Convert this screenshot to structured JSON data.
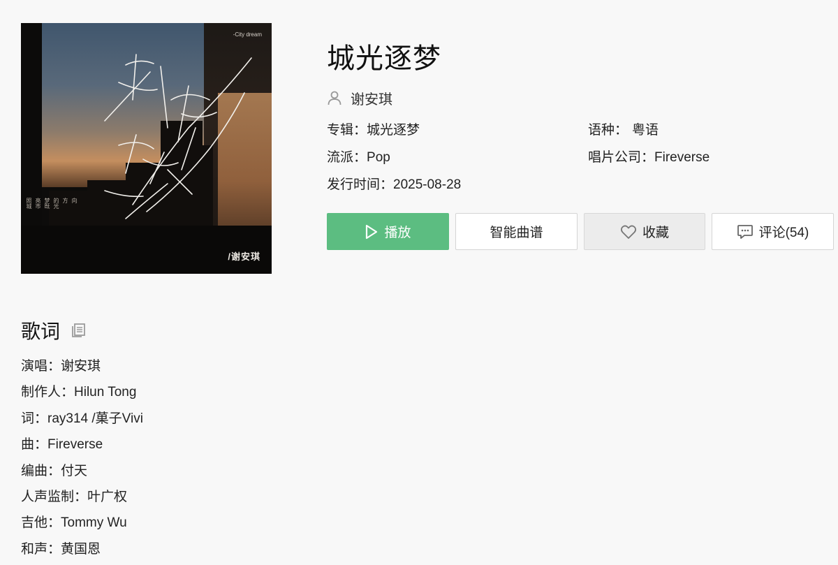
{
  "album_cover": {
    "tag_text": "-City dream",
    "artist_signature": "/谢安琪",
    "vertical_lines": [
      "照城",
      "亮市",
      "梦既",
      "的光",
      "方",
      "向"
    ]
  },
  "song": {
    "title": "城光逐梦",
    "artist": "谢安琪"
  },
  "meta": {
    "album_label": "专辑：",
    "album_value": "城光逐梦",
    "language_label": "语种：",
    "language_value": "粤语",
    "genre_label": "流派：",
    "genre_value": "Pop",
    "label_label": "唱片公司：",
    "label_value": "Fireverse",
    "release_label": "发行时间：",
    "release_value": "2025-08-28"
  },
  "actions": {
    "play": "播放",
    "sheet": "智能曲谱",
    "favorite": "收藏",
    "comment": "评论(54)"
  },
  "lyrics": {
    "heading": "歌词",
    "credits": [
      "演唱：谢安琪",
      "制作人：Hilun Tong",
      "词：ray314 /菓子Vivi",
      "曲：Fireverse",
      "编曲：付天",
      "人声监制：叶广权",
      "吉他：Tommy Wu",
      "和声：黄国恩"
    ]
  },
  "colors": {
    "play_button": "#5cbd81",
    "page_background": "#f8f8f8"
  },
  "icons": {
    "artist": "user-icon",
    "play": "play-icon",
    "favorite": "heart-icon",
    "comment": "comment-icon",
    "copy": "copy-icon"
  }
}
